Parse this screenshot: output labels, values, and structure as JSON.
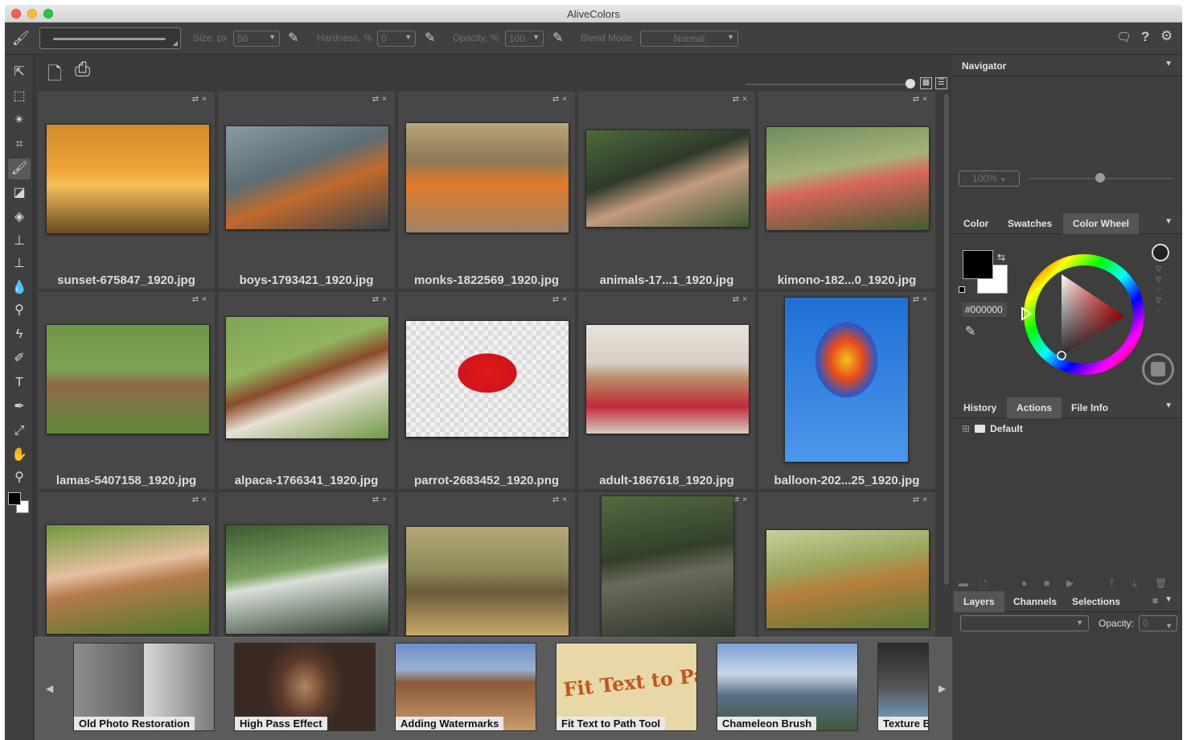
{
  "window": {
    "title": "AliveColors"
  },
  "options": {
    "size_label": "Size, px",
    "size_value": "50",
    "hardness_label": "Hardness, %",
    "hardness_value": "0",
    "opacity_label": "Opacity, %",
    "opacity_value": "100",
    "blend_label": "Blend Mode:",
    "blend_value": "Normal"
  },
  "tools": [
    "move-icon",
    "marquee-icon",
    "magic-wand-icon",
    "crop-icon",
    "brush-icon",
    "eraser-icon",
    "fill-eraser-icon",
    "stamp-icon",
    "healing-icon",
    "blur-icon",
    "dodge-icon",
    "smudge-icon",
    "mixer-brush-icon",
    "text-icon",
    "pen-icon",
    "eyedropper-icon",
    "hand-icon",
    "zoom-icon"
  ],
  "files": [
    {
      "name": "sunset-675847_1920.jpg"
    },
    {
      "name": "boys-1793421_1920.jpg"
    },
    {
      "name": "monks-1822569_1920.jpg"
    },
    {
      "name": "animals-17...1_1920.jpg"
    },
    {
      "name": "kimono-182...0_1920.jpg"
    },
    {
      "name": "lamas-5407158_1920.jpg"
    },
    {
      "name": "alpaca-1766341_1920.jpg"
    },
    {
      "name": "parrot-2683452_1920.png"
    },
    {
      "name": "adult-1867618_1920.jpg"
    },
    {
      "name": "balloon-202...25_1920.jpg"
    },
    {
      "name": ""
    },
    {
      "name": ""
    },
    {
      "name": ""
    },
    {
      "name": ""
    },
    {
      "name": ""
    }
  ],
  "tutorials": [
    {
      "label": "Old Photo Restoration"
    },
    {
      "label": "High Pass Effect"
    },
    {
      "label": "Adding Watermarks"
    },
    {
      "label": "Fit Text to Path Tool"
    },
    {
      "label": "Chameleon Brush"
    },
    {
      "label": "Texture B"
    }
  ],
  "fit_text_art": "Fit Text to Path",
  "navigator": {
    "title": "Navigator",
    "zoom": "100%"
  },
  "color_panel": {
    "tabs": [
      "Color",
      "Swatches",
      "Color Wheel"
    ],
    "active_tab": "Color Wheel",
    "hex": "#000000",
    "foreground": "#000000",
    "background": "#ffffff"
  },
  "history_panel": {
    "tabs": [
      "History",
      "Actions",
      "File Info"
    ],
    "active_tab": "Actions",
    "items": [
      "Default"
    ]
  },
  "layers_panel": {
    "tabs": [
      "Layers",
      "Channels",
      "Selections"
    ],
    "active_tab": "Layers",
    "opacity_label": "Opacity:",
    "opacity_value": "0"
  }
}
